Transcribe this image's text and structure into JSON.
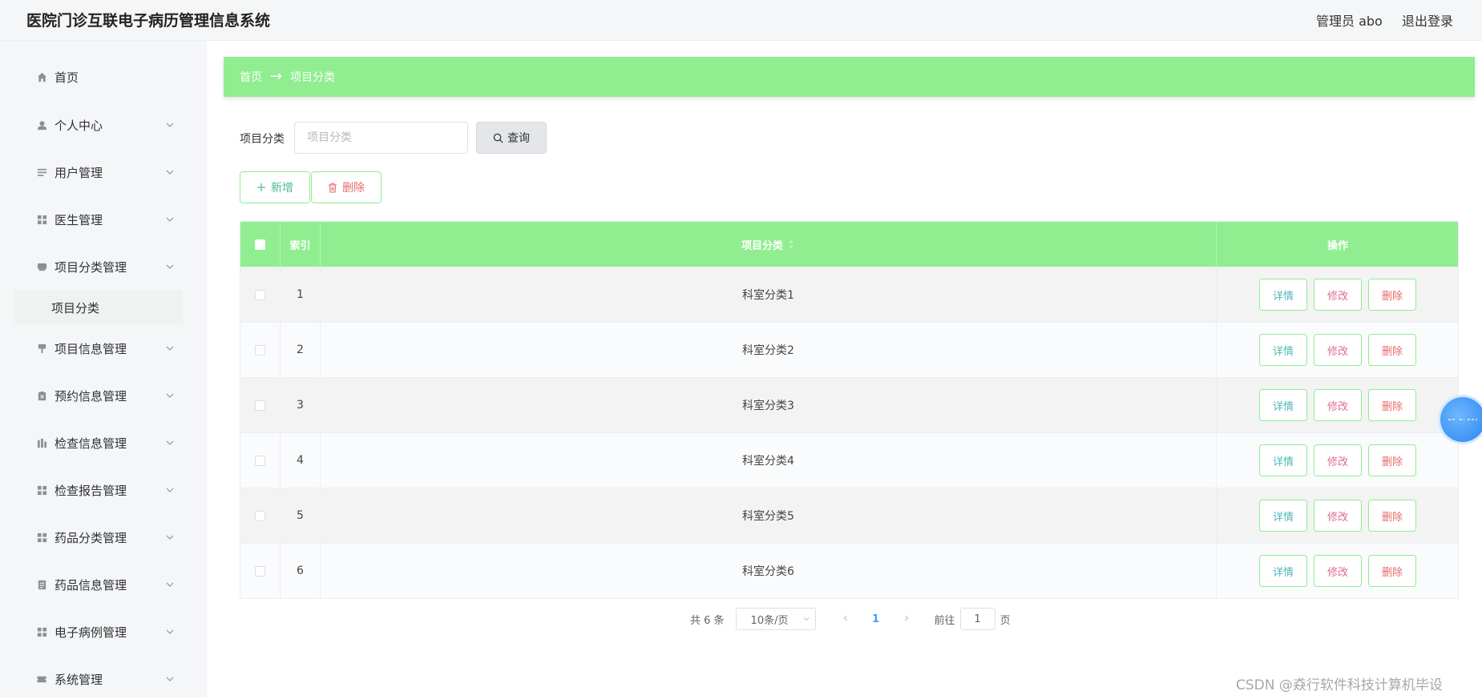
{
  "header": {
    "title": "医院门诊互联电子病历管理信息系统",
    "user": "管理员 abo",
    "logout": "退出登录"
  },
  "sidebar": {
    "items": [
      {
        "label": "首页",
        "icon": "home-icon"
      },
      {
        "label": "个人中心",
        "icon": "user-icon"
      },
      {
        "label": "用户管理",
        "icon": "list-icon"
      },
      {
        "label": "医生管理",
        "icon": "grid-icon"
      },
      {
        "label": "项目分类管理",
        "icon": "tag-icon"
      },
      {
        "label": "项目信息管理",
        "icon": "pin-icon"
      },
      {
        "label": "预约信息管理",
        "icon": "clipboard-icon"
      },
      {
        "label": "检查信息管理",
        "icon": "chart-icon"
      },
      {
        "label": "检查报告管理",
        "icon": "grid-icon"
      },
      {
        "label": "药品分类管理",
        "icon": "grid-icon"
      },
      {
        "label": "药品信息管理",
        "icon": "document-icon"
      },
      {
        "label": "电子病例管理",
        "icon": "grid-icon"
      },
      {
        "label": "系统管理",
        "icon": "ticket-icon"
      }
    ],
    "sub_item": "项目分类"
  },
  "breadcrumb": {
    "home": "首页",
    "separator": "→",
    "current": "项目分类"
  },
  "search": {
    "label": "项目分类",
    "placeholder": "项目分类",
    "button": "查询"
  },
  "actions": {
    "add": "新增",
    "delete": "删除"
  },
  "table": {
    "headers": {
      "index": "索引",
      "name": "项目分类",
      "ops": "操作"
    },
    "rows": [
      {
        "index": "1",
        "name": "科室分类1"
      },
      {
        "index": "2",
        "name": "科室分类2"
      },
      {
        "index": "3",
        "name": "科室分类3"
      },
      {
        "index": "4",
        "name": "科室分类4"
      },
      {
        "index": "5",
        "name": "科室分类5"
      },
      {
        "index": "6",
        "name": "科室分类6"
      }
    ],
    "op_labels": {
      "detail": "详情",
      "edit": "修改",
      "delete": "删除"
    }
  },
  "pagination": {
    "total": "共 6 条",
    "page_size": "10条/页",
    "current_page": "1",
    "goto_prefix": "前往",
    "goto_value": "1",
    "goto_suffix": "页"
  },
  "watermark": "CSDN @猋行软件科技计算机毕设",
  "colors": {
    "accent": "#90ee90",
    "detail": "#4fb8b8",
    "edit": "#e06c8f",
    "delete": "#e76a6a"
  }
}
